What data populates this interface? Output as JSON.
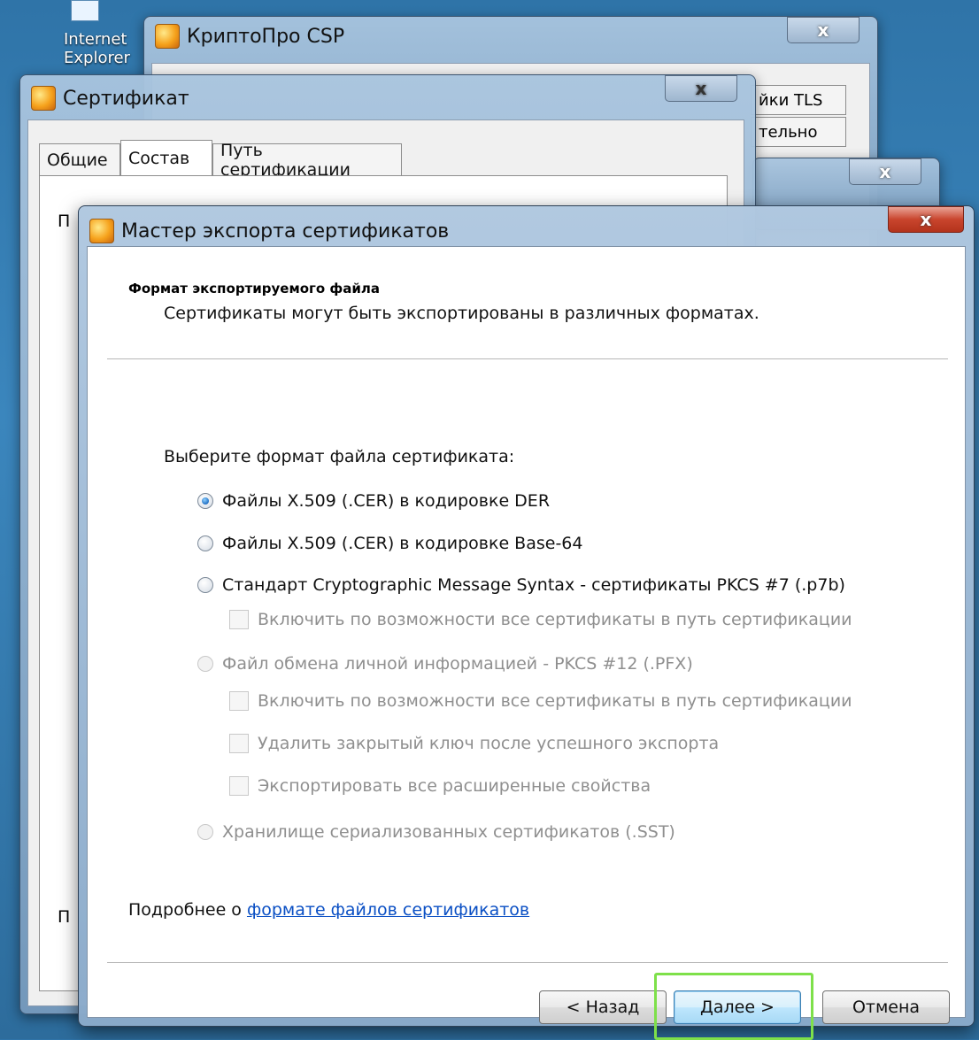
{
  "desktop": {
    "icon_label": "Internet Explorer"
  },
  "cryptopro": {
    "title": "КриптоПро CSP",
    "close_label": "x",
    "tab_tls": "йки TLS",
    "tab_extra": "тельно"
  },
  "third_window": {
    "close_label": "x"
  },
  "certificate": {
    "title": "Сертификат",
    "close_label": "x",
    "tabs": [
      "Общие",
      "Состав",
      "Путь сертификации"
    ],
    "partial_label_1": "П",
    "partial_label_2": "П"
  },
  "wizard": {
    "title": "Мастер экспорта сертификатов",
    "close_label": "x",
    "header_title": "Формат экспортируемого файла",
    "header_subtitle": "Сертификаты могут быть экспортированы в различных форматах.",
    "prompt": "Выберите формат файла сертификата:",
    "options": {
      "der": "Файлы X.509 (.CER) в кодировке DER",
      "base64": "Файлы X.509 (.CER) в кодировке Base-64",
      "pkcs7": "Стандарт Cryptographic Message Syntax - сертификаты PKCS #7 (.p7b)",
      "pkcs7_include": "Включить по возможности все сертификаты в путь сертификации",
      "pfx": "Файл обмена личной информацией - PKCS #12 (.PFX)",
      "pfx_include": "Включить по возможности все сертификаты в путь сертификации",
      "pfx_delete_key": "Удалить закрытый ключ после успешного экспорта",
      "pfx_export_props": "Экспортировать все расширенные свойства",
      "sst": "Хранилище сериализованных сертификатов (.SST)"
    },
    "selected_option": "der",
    "more_prefix": "Подробнее о ",
    "more_link": "формате файлов сертификатов",
    "buttons": {
      "back": "< Назад",
      "next": "Далее >",
      "cancel": "Отмена"
    }
  },
  "colors": {
    "highlight": "#7ee04a",
    "link": "#0a4fc4",
    "close_red": "#c9452d"
  }
}
